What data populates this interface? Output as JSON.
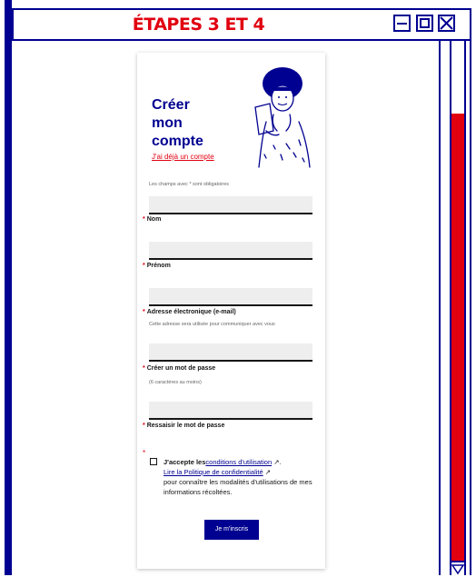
{
  "window": {
    "title": "ÉTAPES 3 ET 4"
  },
  "colors": {
    "brand_blue": "#000091",
    "brand_red": "#e1000f",
    "field_bg": "#eeeeee"
  },
  "form": {
    "heading_lines": [
      "Créer",
      "mon",
      "compte"
    ],
    "login_link": "J'ai déjà un compte",
    "required_note": "Les champs avec * sont obligatoires",
    "fields": [
      {
        "label": "Nom",
        "value": "",
        "hint": ""
      },
      {
        "label": "Prénom",
        "value": "",
        "hint": ""
      },
      {
        "label": "Adresse électronique (e-mail)",
        "value": "",
        "hint": "Cette adresse sera utilisée pour communiquer avec vous"
      },
      {
        "label": "Créer un mot de passe",
        "value": "",
        "hint": "(6 caractères au moins)"
      },
      {
        "label": "Ressaisir le mot de passe",
        "value": "",
        "hint": ""
      }
    ],
    "required_star": "*",
    "cgu": {
      "prefix": "J'accepte les",
      "terms_link": "conditions d'utilisation",
      "privacy_link": "Lire la Politique de confidentialité",
      "suffix": "pour connaître les modalités d'utilisations de mes informations récoltées.",
      "external_icon": "external-link-icon"
    },
    "submit_label": "Je m'inscris"
  }
}
